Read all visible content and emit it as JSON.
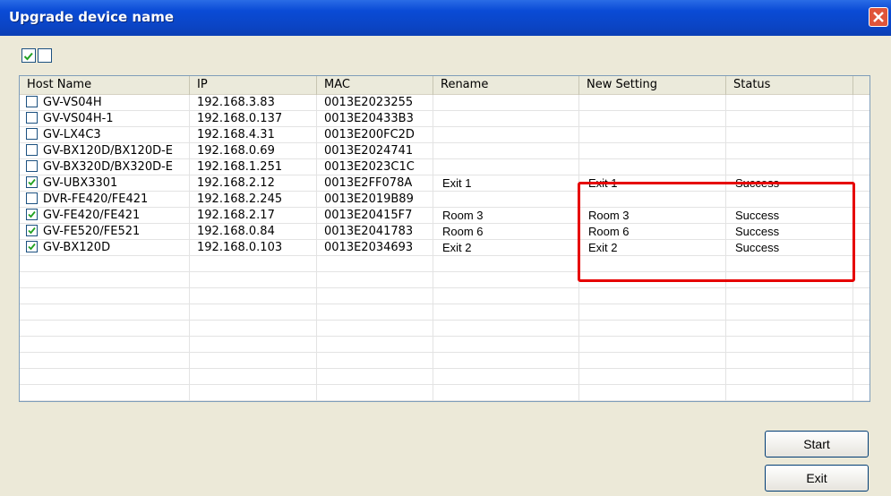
{
  "window": {
    "title": "Upgrade device name"
  },
  "toolbar": {
    "select_all_icon": "checkbox-checked-icon",
    "select_none_icon": "checkbox-empty-icon"
  },
  "columns": [
    "Host Name",
    "IP",
    "MAC",
    "Rename",
    "New Setting",
    "Status"
  ],
  "rows": [
    {
      "checked": false,
      "host": "GV-VS04H",
      "ip": "192.168.3.83",
      "mac": "0013E2023255",
      "rename": "",
      "new_setting": "",
      "status": ""
    },
    {
      "checked": false,
      "host": "GV-VS04H-1",
      "ip": "192.168.0.137",
      "mac": "0013E20433B3",
      "rename": "",
      "new_setting": "",
      "status": ""
    },
    {
      "checked": false,
      "host": "GV-LX4C3",
      "ip": "192.168.4.31",
      "mac": "0013E200FC2D",
      "rename": "",
      "new_setting": "",
      "status": ""
    },
    {
      "checked": false,
      "host": "GV-BX120D/BX120D-E",
      "ip": "192.168.0.69",
      "mac": "0013E2024741",
      "rename": "",
      "new_setting": "",
      "status": ""
    },
    {
      "checked": false,
      "host": "GV-BX320D/BX320D-E",
      "ip": "192.168.1.251",
      "mac": "0013E2023C1C",
      "rename": "",
      "new_setting": "",
      "status": ""
    },
    {
      "checked": true,
      "host": "GV-UBX3301",
      "ip": "192.168.2.12",
      "mac": "0013E2FF078A",
      "rename": "Exit 1",
      "new_setting": "Exit 1",
      "status": "Success"
    },
    {
      "checked": false,
      "host": "DVR-FE420/FE421",
      "ip": "192.168.2.245",
      "mac": "0013E2019B89",
      "rename": "",
      "new_setting": "",
      "status": ""
    },
    {
      "checked": true,
      "host": "GV-FE420/FE421",
      "ip": "192.168.2.17",
      "mac": "0013E20415F7",
      "rename": "Room 3",
      "new_setting": "Room 3",
      "status": "Success"
    },
    {
      "checked": true,
      "host": "GV-FE520/FE521",
      "ip": "192.168.0.84",
      "mac": "0013E2041783",
      "rename": "Room 6",
      "new_setting": "Room 6",
      "status": "Success"
    },
    {
      "checked": true,
      "host": "GV-BX120D",
      "ip": "192.168.0.103",
      "mac": "0013E2034693",
      "rename": "Exit 2",
      "new_setting": "Exit 2",
      "status": "Success"
    }
  ],
  "buttons": {
    "start": "Start",
    "exit": "Exit"
  },
  "colors": {
    "title_bar": "#0b45c6",
    "highlight_box": "#e60000",
    "close_button": "#e0553a"
  }
}
